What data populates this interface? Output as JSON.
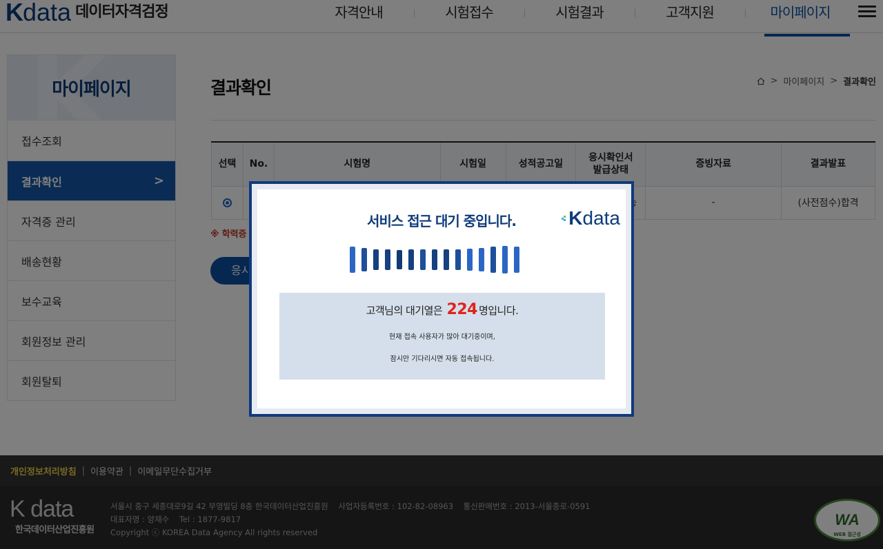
{
  "header": {
    "logo_k": "K",
    "logo_data": "data",
    "logo_sub": "데이터자격검정",
    "nav": [
      "자격안내",
      "시험접수",
      "시험결과",
      "고객지원",
      "마이페이지"
    ],
    "active_nav_index": 4
  },
  "sidebar": {
    "title": "마이페이지",
    "items": [
      "접수조회",
      "결과확인",
      "자격증 관리",
      "배송현황",
      "보수교육",
      "회원정보 관리",
      "회원탈퇴"
    ],
    "active_index": 1,
    "active_chevron": ">"
  },
  "content": {
    "title": "결과확인",
    "breadcrumb": [
      "마이페이지",
      "결과확인"
    ],
    "breadcrumb_sep": ">",
    "table": {
      "headers": [
        "선택",
        "No.",
        "시험명",
        "시험일",
        "성적공고일",
        "응시확인서\n발급상태",
        "증빙자료",
        "결과발표"
      ],
      "row": {
        "confirm_partial": "능",
        "evidence": "-",
        "result": "(사전점수)합격"
      }
    },
    "notice_mark": "※",
    "notice_partial": "학력증",
    "button_partial": "응시"
  },
  "modal": {
    "title": "서비스 접근 대기 중입니다.",
    "logo_k": "K",
    "logo_data": "data",
    "queue_prefix": "고객님의 대기열은",
    "queue_count": "224",
    "queue_suffix": "명입니다.",
    "note_line1": "현재 접속 사용자가 많아 대기중이며,",
    "note_line2": "잠시만 기다리시면 자동 접속됩니다.",
    "loader_colors": [
      "#2b66c4",
      "#1e4f9c",
      "#16407f",
      "#16407f",
      "#133a73",
      "#16407f",
      "#1e4f9c",
      "#16407f",
      "#16407f",
      "#1e4f9c",
      "#2b66c4",
      "#2b66c4",
      "#1e4f9c",
      "#2b66c4",
      "#2b66c4"
    ]
  },
  "footer": {
    "links": [
      "개인정보처리방침",
      "이용약관",
      "이메일무단수집거부"
    ],
    "logo_main": "K data",
    "logo_sub": "한국데이터산업진흥원",
    "info_line1": "서울시 중구 세종대로9길 42 부영빌딩 8층 한국데이터산업진흥원    사업자등록번호 : 102-82-08963    통신판매번호 : 2013-서울종로-0591",
    "info_line2": "대표자명 : 양재수    Tel : 1877-9817",
    "info_line3": "Copyright ⓒ KOREA Data Agency All rights reserved",
    "badge_text": "WA",
    "badge_sub": "WEB 접근성"
  },
  "colors": {
    "brand": "#0d3b7a",
    "accent": "#1557a8",
    "highlight": "#e0241b"
  }
}
